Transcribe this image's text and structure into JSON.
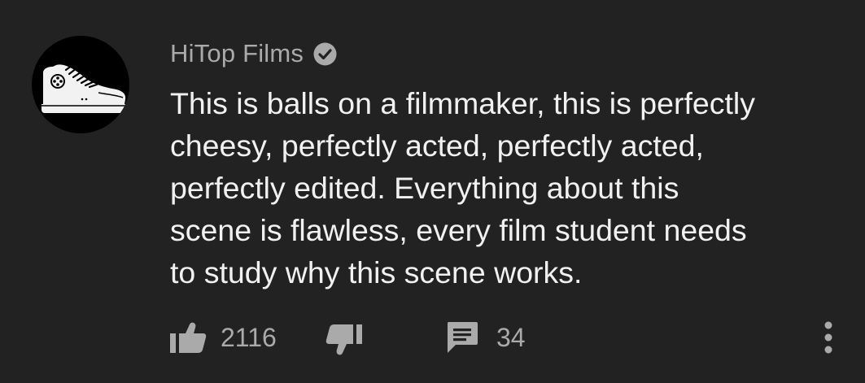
{
  "comment": {
    "author": "HiTop Films",
    "author_verified": true,
    "text": "This is balls on a filmmaker, this is perfectly\ncheesy, perfectly acted, perfectly acted,\nperfectly edited. Everything about this\nscene is flawless, every film student needs\nto study why this scene works.",
    "like_count": "2116",
    "reply_count": "34"
  },
  "icons": {
    "avatar": "sneaker-logo",
    "verified": "verified-check-icon",
    "like": "thumbs-up-icon",
    "dislike": "thumbs-down-icon",
    "reply": "comment-icon",
    "more": "more-vertical-icon"
  },
  "colors": {
    "background": "#222222",
    "text_primary": "#f1f1f1",
    "text_secondary": "#aaaaaa",
    "avatar_bg": "#000000"
  }
}
